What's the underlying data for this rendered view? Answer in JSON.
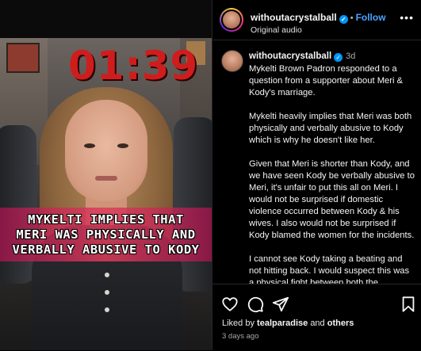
{
  "video": {
    "timer": "01:39",
    "caption_lines": [
      "MYKELTI IMPLIES THAT",
      "MERI WAS PHYSICALLY AND",
      "VERBALLY ABUSIVE TO KODY"
    ]
  },
  "header": {
    "username": "withoutacrystalball",
    "separator": "•",
    "follow_label": "Follow",
    "audio_label": "Original audio",
    "more_label": "•••"
  },
  "comment": {
    "username": "withoutacrystalball",
    "time": "3d",
    "paragraphs": [
      "Mykelti Brown Padron responded to a question from a supporter about Meri & Kody's marriage.",
      "Mykelti heavily implies that Meri was both physically and verbally abusive to Kody which is why he doesn't like her.",
      "Given that Meri is shorter than Kody, and we have seen Kody be verbally abusive to Meri, it's unfair to put this all on Meri. I would not be surprised if domestic violence occurred between Kody & his wives. I also would not be surprised if Kody blamed the women for the incidents.",
      "I cannot see Kody taking a beating and not hitting back. I would suspect this was a physical fight between both the"
    ]
  },
  "footer": {
    "liked_prefix": "Liked by",
    "liked_user": "tealparadise",
    "liked_and": "and",
    "liked_others": "others",
    "time_ago": "3 days ago"
  },
  "colors": {
    "follow": "#4aa3ff",
    "verified": "#0095f6",
    "timer": "#cf1d1d"
  },
  "icons": [
    "heart-icon",
    "comment-icon",
    "share-icon",
    "bookmark-icon",
    "verified-icon",
    "more-icon"
  ]
}
